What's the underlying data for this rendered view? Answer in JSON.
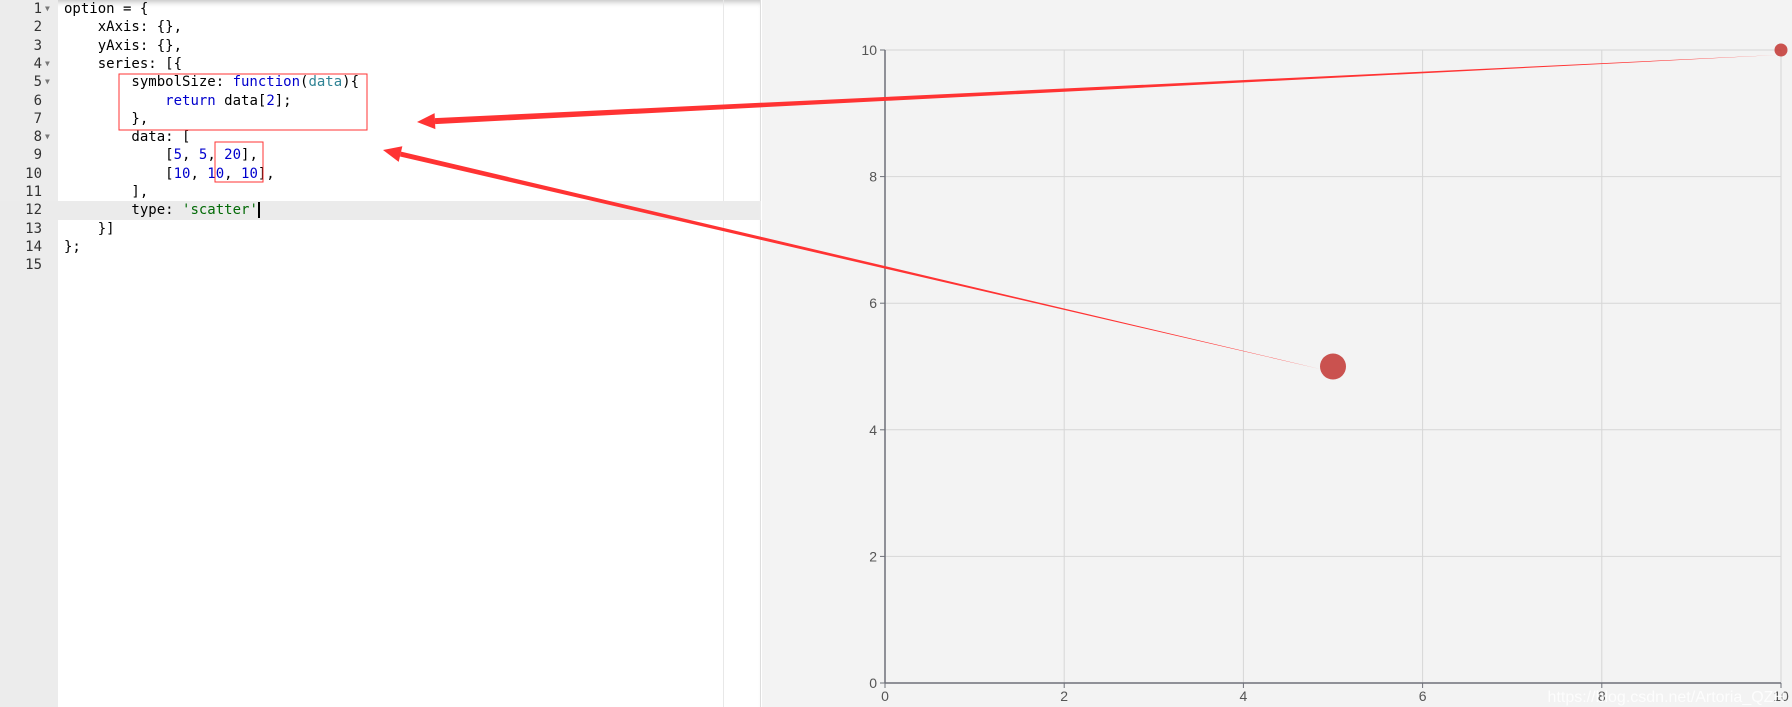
{
  "editor": {
    "lines": [
      {
        "n": "1",
        "fold": true,
        "html": "option = {"
      },
      {
        "n": "2",
        "html": "    xAxis: {},"
      },
      {
        "n": "3",
        "html": "    yAxis: {},"
      },
      {
        "n": "4",
        "fold": true,
        "html": "    series: [{"
      },
      {
        "n": "5",
        "fold": true,
        "html": "        symbolSize: <k>function</k>(<v>data</v>){"
      },
      {
        "n": "6",
        "html": "            <k>return</k> data[<k>2</k>];"
      },
      {
        "n": "7",
        "html": "        },"
      },
      {
        "n": "8",
        "fold": true,
        "html": "        data: ["
      },
      {
        "n": "9",
        "html": "            [<k>5</k>, <k>5</k>, <k>20</k>],"
      },
      {
        "n": "10",
        "html": "            [<k>10</k>, <k>10</k>, <k>10</k>],"
      },
      {
        "n": "11",
        "html": "        ],"
      },
      {
        "n": "12",
        "active": true,
        "html": "        type: <s>'scatter'</s><c></c>"
      },
      {
        "n": "13",
        "html": "    }]"
      },
      {
        "n": "14",
        "html": "};"
      },
      {
        "n": "15",
        "html": ""
      }
    ]
  },
  "annotation_color": "#ff3333",
  "watermark": "https://blog.csdn.net/Artoria_QZH",
  "chart_data": {
    "type": "scatter",
    "xlim": [
      0,
      10
    ],
    "ylim": [
      0,
      10
    ],
    "xticks": [
      "0",
      "2",
      "4",
      "6",
      "8",
      "10"
    ],
    "yticks": [
      "0",
      "2",
      "4",
      "6",
      "8",
      "10"
    ],
    "grid": true,
    "points": [
      {
        "x": 5,
        "y": 5,
        "size": 20
      },
      {
        "x": 10,
        "y": 10,
        "size": 10
      }
    ],
    "color": "#c23531"
  }
}
